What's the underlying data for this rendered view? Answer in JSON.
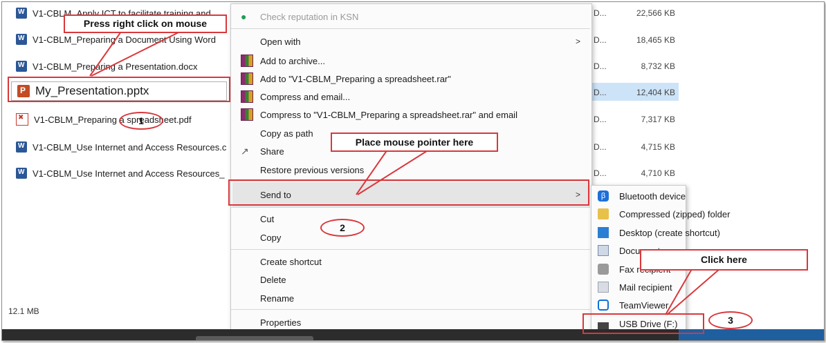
{
  "files": [
    {
      "name": "V1-CBLM_Apply ICT to facilitate training and",
      "icon": "word-icon"
    },
    {
      "name": "V1-CBLM_Preparing a Document Using Word",
      "icon": "word-icon"
    },
    {
      "name": "V1-CBLM_Preparing a Presentation.docx",
      "icon": "word-icon"
    },
    {
      "name": "My_Presentation.pptx",
      "icon": "powerpoint-icon"
    },
    {
      "name": "V1-CBLM_Preparing a spreadsheet.pdf",
      "icon": "pdf-icon"
    },
    {
      "name": "V1-CBLM_Use Internet and Access Resources.c",
      "icon": "word-icon"
    },
    {
      "name": "V1-CBLM_Use Internet and Access Resources_",
      "icon": "word-icon"
    }
  ],
  "types": [
    "D...",
    "D...",
    "D...",
    "D...",
    "D...",
    "D...",
    "D..."
  ],
  "sizes": [
    "22,566 KB",
    "18,465 KB",
    "8,732 KB",
    "12,404 KB",
    "7,317 KB",
    "4,715 KB",
    "4,710 KB"
  ],
  "status_size": "12.1 MB",
  "context_menu": {
    "check_ksn": "Check reputation in KSN",
    "open_with": "Open with",
    "add_archive": "Add to archive...",
    "add_rar": "Add to \"V1-CBLM_Preparing a spreadsheet.rar\"",
    "compress_email": "Compress and email...",
    "compress_rar_email": "Compress to \"V1-CBLM_Preparing a spreadsheet.rar\" and email",
    "copy_path": "Copy as path",
    "share": "Share",
    "restore": "Restore previous versions",
    "send_to": "Send to",
    "cut": "Cut",
    "copy": "Copy",
    "create_shortcut": "Create shortcut",
    "delete": "Delete",
    "rename": "Rename",
    "properties": "Properties",
    "arrow": ">"
  },
  "send_to_menu": [
    {
      "label": "Bluetooth device",
      "icon": "bluetooth-icon"
    },
    {
      "label": "Compressed (zipped) folder",
      "icon": "zip-folder-icon"
    },
    {
      "label": "Desktop (create shortcut)",
      "icon": "desktop-icon"
    },
    {
      "label": "Documents",
      "icon": "documents-icon"
    },
    {
      "label": "Fax recipient",
      "icon": "fax-icon"
    },
    {
      "label": "Mail recipient",
      "icon": "mail-icon"
    },
    {
      "label": "TeamViewer",
      "icon": "teamviewer-icon"
    },
    {
      "label": "USB Drive (F:)",
      "icon": "usb-drive-icon"
    }
  ],
  "annotations": {
    "right_click": "Press right click on mouse",
    "place_pointer": "Place mouse pointer here",
    "click_here": "Click here",
    "step1": "1",
    "step2": "2",
    "step3": "3"
  },
  "colors": {
    "annotation_red": "#d9373b",
    "selection_blue": "#cde3f7"
  }
}
